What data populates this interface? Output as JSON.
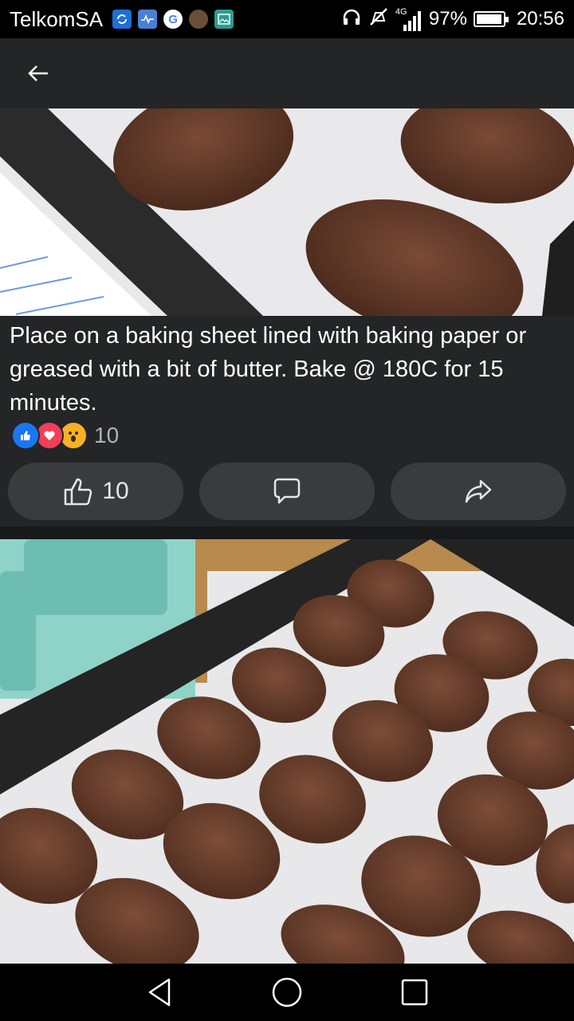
{
  "status_bar": {
    "carrier": "TelkomSA",
    "network": "4G",
    "battery": "97%",
    "battery_level": 0.97,
    "time": "20:56",
    "notification_icons": [
      "sync-icon",
      "health-icon",
      "google-icon",
      "contact-icon",
      "gallery-icon"
    ],
    "system_icons": [
      "headphones-icon",
      "mute-icon",
      "signal-icon",
      "battery-icon"
    ]
  },
  "app_bar": {
    "back_icon": "back-arrow-icon"
  },
  "post": {
    "caption": "Place on a baking sheet lined with baking paper or greased with a bit of butter. Bake @ 180C for 15 minutes.",
    "reactions": [
      "like",
      "love",
      "wow"
    ],
    "reaction_count": "10",
    "like_count": "10"
  },
  "colors": {
    "background": "#18191a",
    "card": "#242526",
    "button": "#3a3b3c",
    "like_blue": "#1877f2",
    "love_red": "#f33e58",
    "wow_yellow": "#f7b125"
  },
  "nav": {
    "icons": [
      "back-nav-icon",
      "home-nav-icon",
      "recents-nav-icon"
    ]
  }
}
